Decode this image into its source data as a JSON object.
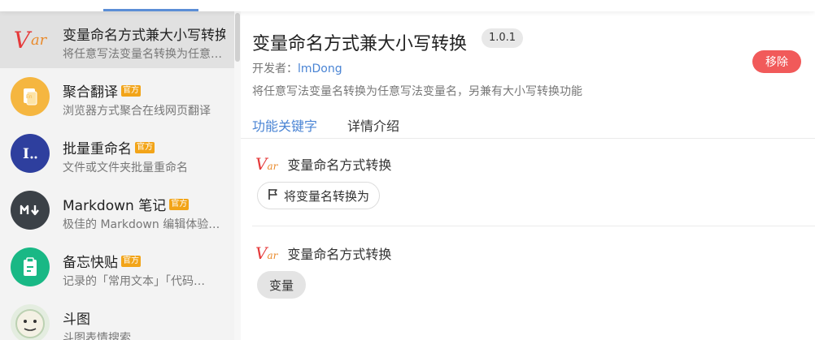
{
  "sidebar": {
    "items": [
      {
        "title": "变量命名方式兼大小写转换",
        "desc": "将任意写法变量名转换为任意写法变量名，另兼有大小写转换功能",
        "official": false,
        "icon": "var-logo-icon",
        "icon_color": "#e5393a",
        "active": true
      },
      {
        "title": "聚合翻译",
        "desc": "浏览器方式聚合在线网页翻译",
        "official": true,
        "badge": "官方",
        "icon": "translate-icon",
        "icon_color": "#f5b640"
      },
      {
        "title": "批量重命名",
        "desc": "文件或文件夹批量重命名",
        "official": true,
        "badge": "官方",
        "icon": "rename-icon",
        "icon_color": "#2e3f9e"
      },
      {
        "title": "Markdown 笔记",
        "desc": "极佳的 Markdown 编辑体验…",
        "official": true,
        "badge": "官方",
        "icon": "markdown-icon",
        "icon_color": "#3b4147"
      },
      {
        "title": "备忘快贴",
        "desc": "记录的「常用文本」「代码…",
        "official": true,
        "badge": "官方",
        "icon": "clipboard-icon",
        "icon_color": "#19b885"
      },
      {
        "title": "斗图",
        "desc": "斗图表情搜索",
        "official": false,
        "icon": "meme-face-icon",
        "icon_color": "#cfe3c5"
      }
    ]
  },
  "detail": {
    "title": "变量命名方式兼大小写转换",
    "version": "1.0.1",
    "developer_label": "开发者：",
    "developer_name": "lmDong",
    "description": "将任意写法变量名转换为任意写法变量名，另兼有大小写转换功能",
    "remove_label": "移除",
    "tabs": [
      "功能关键字",
      "详情介绍"
    ],
    "features": [
      {
        "name": "变量命名方式转换",
        "command": "将变量名转换为",
        "command_icon": "flag-icon"
      },
      {
        "name": "变量命名方式转换",
        "command": "变量"
      }
    ]
  },
  "colors": {
    "accent": "#4a84d4",
    "danger": "#f15a5a",
    "badge": "#f2a418"
  }
}
